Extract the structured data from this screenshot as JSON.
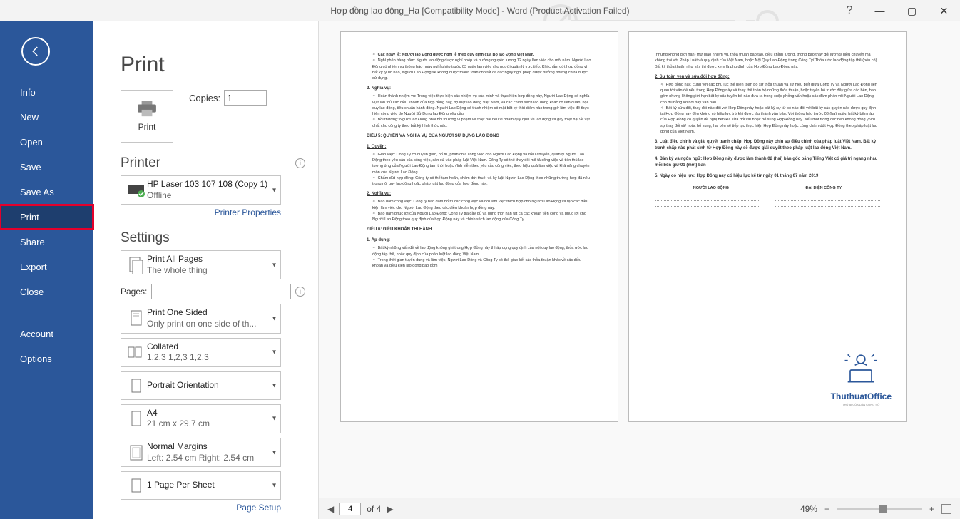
{
  "titlebar": {
    "title": "Hợp đồng lao động_Ha [Compatibility Mode] - Word (Product Activation Failed)",
    "help": "?",
    "minimize": "—",
    "maximize": "▢",
    "close": "✕"
  },
  "nav": {
    "back": "←",
    "items": [
      "Info",
      "New",
      "Open",
      "Save",
      "Save As",
      "Print",
      "Share",
      "Export",
      "Close"
    ],
    "footer": [
      "Account",
      "Options"
    ]
  },
  "content": {
    "heading": "Print",
    "print_btn": "Print",
    "copies_label": "Copies:",
    "copies_value": "1",
    "printer_label": "Printer",
    "printer": {
      "name": "HP Laser 103 107 108 (Copy 1)",
      "status": "Offline"
    },
    "printer_props": "Printer Properties",
    "settings_label": "Settings",
    "print_all": {
      "title": "Print All Pages",
      "sub": "The whole thing"
    },
    "pages_label": "Pages:",
    "one_sided": {
      "title": "Print One Sided",
      "sub": "Only print on one side of th..."
    },
    "collated": {
      "title": "Collated",
      "sub": "1,2,3    1,2,3    1,2,3"
    },
    "orientation": {
      "title": "Portrait Orientation"
    },
    "paper": {
      "title": "A4",
      "sub": "21 cm x 29.7 cm"
    },
    "margins": {
      "title": "Normal Margins",
      "sub": "Left:  2.54 cm    Right:  2.54 cm"
    },
    "per_sheet": {
      "title": "1 Page Per Sheet"
    },
    "page_setup": "Page Setup"
  },
  "preview": {
    "footer": {
      "page_current": "4",
      "page_total": "of 4",
      "zoom": "49%",
      "minus": "−",
      "plus": "+"
    }
  },
  "doc_page1": {
    "i1": "Các ngày lễ: Người lao Động được nghỉ lễ theo quy định của Bộ lao Động Việt Nam.",
    "i2": "Nghỉ phép hàng năm: Người lao động được nghỉ phép và hưởng nguyên lương 12 ngày làm việc cho mỗi năm. Người Lao Động có nhiệm vụ thông báo ngày nghỉ phép trước 03 ngày làm việc cho người quản lý trực tiếp. Khi chấm dứt hợp đồng vì bất kỳ lý do nào, Người Lao Động sẽ không được thanh toán cho tất cả các ngày nghỉ phép được hưởng nhưng chưa được sử dụng.",
    "h2": "2. Nghĩa vụ:",
    "i3": "Hoàn thành nhiệm vụ: Trong việc thực hiện các nhiệm vụ của mình và thực hiện hợp đồng này, Người Lao Động có nghĩa vụ tuân thủ các điều khoản của hợp đồng này, bộ luật lao động Việt Nam, và các chính sách lao động khác có liên quan, nội quy lao động, tiêu chuẩn hành động. Người Lao Động có trách nhiệm có mặt bắt kỳ thời điểm nào trong giờ làm việc để thực hiện công việc do Người Sử Dụng lao Động yêu cầu.",
    "i4": "Bồi thường: Người lao Động phải bồi thường vi phạm và thiệt hại nếu vi phạm quy định về lao động và gây thiệt hại về vật chất cho công ty theo bất kỳ hình thức nào.",
    "h3": "ĐIỀU 5: QUYỀN VÀ NGHĨA VỤ CỦA NGƯỜI SỬ DỤNG LAO ĐỘNG",
    "h4": "1. Quyền:",
    "i5": "Giao việc: Công Ty có quyền giao, bố trí, phân chia công việc cho Người Lao Động và điều chuyển, quản lý Người Lao Động theo yêu cầu của công việc, cần cứ vào pháp luật Việt Nam. Công Ty có thể thay đổi mô tả công việc và tiền thù lao tương ứng của Người Lao Động tạm thời hoặc vĩnh viễn theo yêu cầu công việc, theo hiệu quả làm việc và khả năng chuyên môn của Người Lao Động.",
    "i6": "Chấm dứt hợp đồng: Công ty có thể tạm hoãn, chấm dứt thuê, và kỷ luật Người Lao Động theo những trường hợp đã nêu trong nội quy lao động hoặc pháp luật lao động của hợp đồng này.",
    "h5": "2. Nghĩa vụ:",
    "i7": "Bảo đảm công việc: Công ty bảo đảm bố trí các công việc và nơi làm việc thích hợp cho Người Lao Động và tạo các điều kiện làm việc cho Người Lao Động theo các điều khoản hợp đồng này.",
    "i8": "Bảo đảm phúc lợi của Người Lao Động: Công Ty trả đầy đủ và đúng thời hạn tất cả các khoản tiền công và phúc lợi cho Người Lao Động theo quy định của hợp Động này và chính sách lao động của Công Ty.",
    "h6": "ĐIỀU 6: ĐIỀU KHOẢN THI HÀNH",
    "h7": "1. Áp dụng:",
    "i9": "Bất kỳ những vấn đề về lao động không ghi trong Hợp Đồng này thì áp dụng quy định của nội quy lao động, thỏa ước lao động tập thể, hoặc quy định của pháp luật lao động Việt Nam.",
    "i10": "Trong thời gian tuyển dụng và làm việc, Người Lao Động và Công Ty có thể giao kết các thỏa thuận khác về các điều khoản và điều kiện lao động bao gồm"
  },
  "doc_page2": {
    "p1": "(nhưng không giới hạn) thư giao nhiệm vụ, thỏa thuận đào tạo, điều chỉnh lương, thông báo thay đổi lương/ điều chuyển mà không trái với Pháp Luật và quy định của Việt Nam, hoặc Nội Quy Lao Động trong Công Ty/ Thỏa ước lao động tập thể (nếu có). Bất kỳ thỏa thuận như vậy thì được xem là phụ đính của Hợp Đồng Lao Động này.",
    "h2": "2. Sự toàn vẹn và sửa đổi hợp đồng:",
    "i1": "Hợp đồng này, cùng với các phụ lục thể hiện toàn bộ sự thỏa thuận và sự hiểu biết giữa Công Ty và Người Lao Động liên quan tới vấn đề nêu trong Hợp Đồng này và thay thế toàn bộ những thỏa thuận, hoặc tuyên bố trước đây giữa các bên, bao gồm nhưng không giới hạn bất kỳ các tuyên bố nào đưa ra trong cuộc phỏng vấn hoặc các đàm phán với Người Lao Động cho dù bằng lời nói hay văn bản.",
    "i2": "Bất kỳ sửa đổi, thay đổi nào đối với Hợp Đồng này hoặc bất kỳ sự từ bỏ nào đối với bất kỳ các quyền nào được quy định tại Hợp Đồng này đều không có hiệu lực trừ khi được lập thành văn bản. Với thông báo trước 03 (ba) ngày, bất kỳ bên nào của Hợp Đồng có quyền đề nghị bên kia sửa đổi và/ hoặc bổ sung Hợp Đồng này. Nếu một trong các bên không đồng ý với sự thay đổi và/ hoặc bổ sung, hai bên sẽ tiếp tục thực hiện Hợp Đồng này hoặc cùng chấm dứt Hợp Đồng theo pháp luật lao động của Việt Nam.",
    "h3": "3. Luật điều chỉnh và giải quyết tranh chấp: Hợp Đồng này chịu sự điều chỉnh của pháp luật Việt Nam. Bất kỳ tranh chấp nào phát sinh từ Hợp Đồng này sẽ được giải quyết theo pháp luật lao động Việt Nam.",
    "h4": "4. Bản ký và ngôn ngữ: Hợp Đồng này được làm thành 02 (hai) bản gốc bằng Tiếng Việt có giá trị ngang nhau mỗi bên giữ 01 (một) bản",
    "h5": "5. Ngày có hiệu lực: Hợp Đồng này có hiệu lực kể từ ngày  01  tháng  07  năm 2019",
    "sig1": "NGƯỜI LAO ĐỘNG",
    "sig2": "ĐẠI DIỆN CÔNG TY",
    "brand": "ThuthuatOffice",
    "tag": "THỦ BỊ CỦA DÂN CÔNG SỞ"
  }
}
